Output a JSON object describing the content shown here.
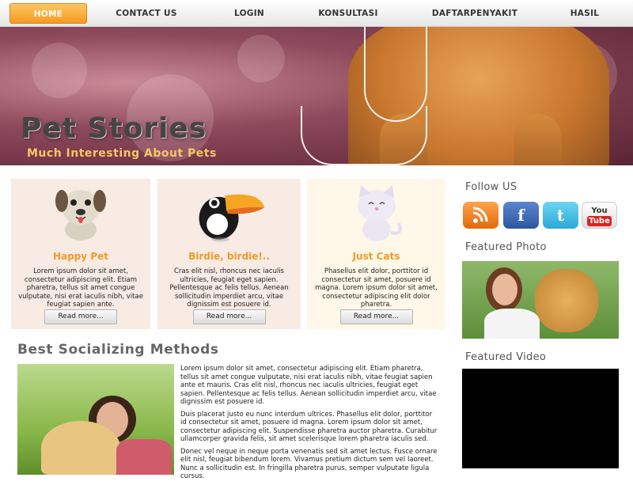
{
  "nav": {
    "items": [
      "HOME",
      "CONTACT US",
      "LOGIN",
      "KONSULTASI",
      "DAFTARPENYAKIT",
      "HASIL"
    ]
  },
  "banner": {
    "title": "Pet Stories",
    "subtitle": "Much Interesting About Pets"
  },
  "cards": [
    {
      "title": "Happy Pet",
      "text": "Lorem ipsum dolor sit amet, consectetur adipiscing elit. Etiam pharetra, tellus sit amet congue vulputate, nisi erat iaculis nibh, vitae feugiat sapien ante.",
      "button": "Read more...",
      "icon": "dog-icon"
    },
    {
      "title": "Birdie, birdie!..",
      "text": "Cras elit nisl, rhoncus nec iaculis ultricies, feugiat eget sapien. Pellentesque ac felis tellus. Aenean sollicitudin imperdiet arcu, vitae dignissim est posuere id.",
      "button": "Read more...",
      "icon": "toucan-icon"
    },
    {
      "title": "Just Cats",
      "text": "Phasellus elit dolor, porttitor id consectetur sit amet, posuere id magna. Lorem ipsum dolor sit amet, consectetur adipiscing elit dolor pharetra.",
      "button": "Read more...",
      "icon": "cat-icon"
    }
  ],
  "main": {
    "title": "Best Socializing Methods",
    "paragraphs": [
      "Lorem ipsum dolor sit amet, consectetur adipiscing elit. Etiam pharetra, tellus sit amet congue vulputate, nisi erat iaculis nibh, vitae feugiat sapien ante et mauris. Cras elit nisl, rhoncus nec iaculis ultricies, feugiat eget sapien. Pellentesque ac felis tellus. Aenean sollicitudin imperdiet arcu, vitae dignissim est posuere id.",
      "Duis placerat justo eu nunc interdum ultrices. Phasellus elit dolor, porttitor id consectetur sit amet, posuere id magna. Lorem ipsum dolor sit amet, consectetur adipiscing elit. Suspendisse pharetra auctor pharetra. Curabitur ullamcorper gravida felis, sit amet scelerisque lorem pharetra iaculis sed.",
      "Donec vel neque in neque porta venenatis sed sit amet lectus. Fusce ornare elit nisl, feugiat bibendum lorem. Vivamus pretium dictum sem vel laoreet. Nunc a sollicitudin est. In fringilla pharetra purus, semper vulputate ligula cursus."
    ]
  },
  "sidebar": {
    "follow_title": "Follow US",
    "featured_photo_title": "Featured Photo",
    "featured_video_title": "Featured Video",
    "social": {
      "facebook": "f",
      "twitter": "t",
      "you": "You",
      "tube": "Tube"
    }
  }
}
